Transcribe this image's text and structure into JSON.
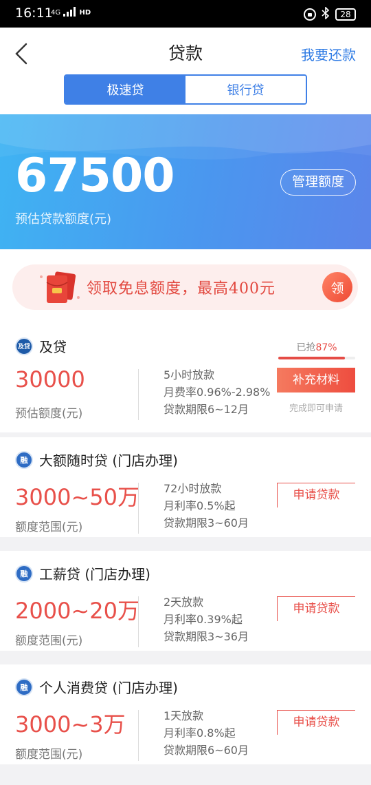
{
  "status_bar": {
    "time": "16:11",
    "network": "4G",
    "hd": "HD",
    "battery": "28"
  },
  "nav": {
    "title": "贷款",
    "repay_label": "我要还款",
    "tabs": [
      {
        "label": "极速贷",
        "active": true
      },
      {
        "label": "银行贷",
        "active": false
      }
    ]
  },
  "quota": {
    "amount": "67500",
    "label": "预估贷款额度(元)",
    "manage_label": "管理额度"
  },
  "promo": {
    "text": "领取免息额度，最高400元",
    "claim_label": "领"
  },
  "loans": [
    {
      "icon_text": "及贷",
      "name": "及贷",
      "amount": "30000",
      "amount_label": "预估额度(元)",
      "details": [
        "5小时放款",
        "月费率0.96%-2.98%",
        "贷款期限6~12月"
      ],
      "grab_prefix": "已抢",
      "grab_pct": "87%",
      "grab_value": 0.87,
      "action_label": "补充材料",
      "action_hint": "完成即可申请"
    },
    {
      "icon_text": "融",
      "name": "大额随时贷 (门店办理)",
      "amount": "3000~50万",
      "amount_label": "额度范围(元)",
      "details": [
        "72小时放款",
        "月利率0.5%起",
        "贷款期限3~60月"
      ],
      "action_label": "申请贷款"
    },
    {
      "icon_text": "融",
      "name": "工薪贷 (门店办理)",
      "amount": "2000~20万",
      "amount_label": "额度范围(元)",
      "details": [
        "2天放款",
        "月利率0.39%起",
        "贷款期限3~36月"
      ],
      "action_label": "申请贷款"
    },
    {
      "icon_text": "融",
      "name": "个人消费贷 (门店办理)",
      "amount": "3000~3万",
      "amount_label": "额度范围(元)",
      "details": [
        "1天放款",
        "月利率0.8%起",
        "贷款期限6~60月"
      ],
      "action_label": "申请贷款"
    }
  ],
  "colors": {
    "accent_blue": "#3f80e6",
    "accent_red": "#e8504a",
    "background": "#f2f2f4"
  }
}
